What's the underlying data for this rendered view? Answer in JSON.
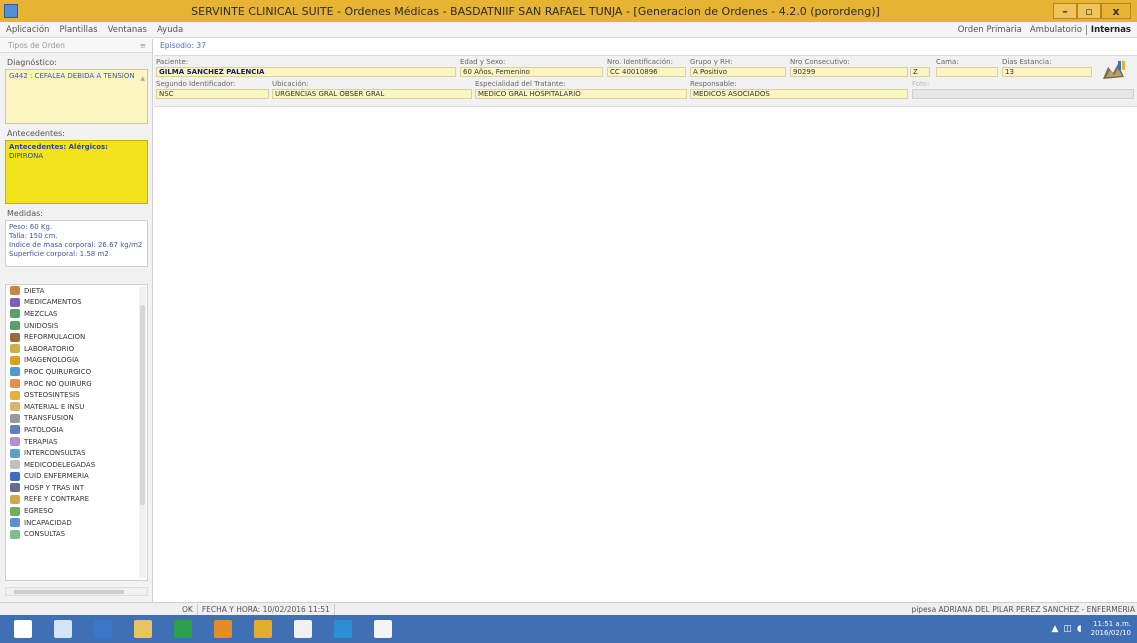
{
  "window": {
    "title": "SERVINTE CLINICAL SUITE - Ordenes Médicas - BASDATNIIF SAN RAFAEL TUNJA - [Generacion de Ordenes - 4.2.0 (porordeng)]",
    "minimize": "–",
    "maximize": "▫",
    "close": "x"
  },
  "menu": {
    "items": [
      "Aplicación",
      "Plantillas",
      "Ventanas",
      "Ayuda"
    ],
    "modes": [
      "Orden Primaria",
      "Ambulatorio",
      "Internas"
    ],
    "active_mode": "Internas"
  },
  "left_panel": {
    "header": "Tipos de Orden",
    "pin": "≡",
    "diagnostico_label": "Diagnóstico:",
    "diagnostico_text": "G442 : CEFALEA DEBIDA A TENSION",
    "antecedentes_label": "Antecedentes:",
    "antecedentes_title": "Antecedentes: Alérgicos:",
    "antecedentes_text": "DIPIRONA",
    "medidas_label": "Medidas:",
    "medidas_lines": [
      "Peso: 60 Kg.",
      "Talla: 150 cm.",
      "Indice de masa corporal: 26.67 kg/m2",
      "Superficie corporal: 1.58 m2"
    ],
    "order_types": [
      {
        "label": "DIETA",
        "color": "#c8873f"
      },
      {
        "label": "MEDICAMENTOS",
        "color": "#7c5fb6"
      },
      {
        "label": "MEZCLAS",
        "color": "#5aa06a"
      },
      {
        "label": "UNIDOSIS",
        "color": "#5aa06a"
      },
      {
        "label": "REFORMULACION",
        "color": "#9b6a3a"
      },
      {
        "label": "LABORATORIO",
        "color": "#c9b24a"
      },
      {
        "label": "IMAGENOLOGIA",
        "color": "#d9a21f"
      },
      {
        "label": "PROC QUIRURGICO",
        "color": "#4d9bd1"
      },
      {
        "label": "PROC NO QUIRURG",
        "color": "#e58f4a"
      },
      {
        "label": "OSTEOSINTESIS",
        "color": "#e0b33a"
      },
      {
        "label": "MATERIAL E INSU",
        "color": "#d8b56a"
      },
      {
        "label": "TRANSFUSION",
        "color": "#9a9a9a"
      },
      {
        "label": "PATOLOGIA",
        "color": "#5f7fbf"
      },
      {
        "label": "TERAPIAS",
        "color": "#b78fd0"
      },
      {
        "label": "INTERCONSULTAS",
        "color": "#5aa0c8"
      },
      {
        "label": "MEDICODELEGADAS",
        "color": "#c0c0c0"
      },
      {
        "label": "CUID ENFERMERIA",
        "color": "#3d6fc0"
      },
      {
        "label": "HOSP Y TRAS INT",
        "color": "#6a6a8a"
      },
      {
        "label": "REFE Y CONTRARE",
        "color": "#d1a84f"
      },
      {
        "label": "EGRESO",
        "color": "#6fae5e"
      },
      {
        "label": "INCAPACIDAD",
        "color": "#5a8fd0"
      },
      {
        "label": "CONSULTAS",
        "color": "#7cbf8a"
      }
    ]
  },
  "main": {
    "episode": "Episodio: 37",
    "labels": {
      "paciente": "Paciente:",
      "edad_sexo": "Edad y Sexo:",
      "nro_ident": "Nro. Identificación:",
      "grupo_rh": "Grupo y RH:",
      "nro_consec": "Nro Consecutivo:",
      "cama": "Cama:",
      "dias_estancia": "Dias Estancia:",
      "segundo_ident": "Segundo Identificador:",
      "ubicacion": "Ubicación:",
      "especialidad": "Especialidad del Tratante:",
      "responsable": "Responsable:",
      "foto": "Foto:"
    },
    "values": {
      "paciente": "GILMA SANCHEZ PALENCIA",
      "edad_sexo": "60 Años, Femenino",
      "nro_ident": "CC 40010896",
      "grupo_rh": "A Positivo",
      "nro_consec": "90299",
      "consec_suffix": "Z",
      "cama": "",
      "dias_estancia": "13",
      "segundo_ident": "NSC",
      "ubicacion": "URGENCIAS GRAL OBSER GRAL",
      "especialidad": "MEDICO GRAL HOSPITALARIO",
      "responsable": "MEDICOS ASOCIADOS"
    }
  },
  "status": {
    "state": "OK",
    "datetime": "FECHA Y HORA: 10/02/2016 11:51",
    "user": "pipesa ADRIANA DEL PILAR PEREZ SANCHEZ - ENFERMERIA"
  },
  "taskbar": {
    "apps": [
      {
        "name": "windows-start",
        "color": "#ffffff"
      },
      {
        "name": "file-explorer",
        "color": "#d4e3f5"
      },
      {
        "name": "app-z",
        "color": "#3a78c7"
      },
      {
        "name": "folder",
        "color": "#e8c460"
      },
      {
        "name": "app-browser",
        "color": "#2b9f4e"
      },
      {
        "name": "app-orange",
        "color": "#e38c2a"
      },
      {
        "name": "app-calc",
        "color": "#e2ad2c"
      },
      {
        "name": "app-settings",
        "color": "#f0f0f0"
      },
      {
        "name": "app-media",
        "color": "#2c8fd6"
      },
      {
        "name": "app-doc",
        "color": "#f4f4f4"
      }
    ],
    "clock_time": "11:51 a.m.",
    "clock_date": "2016/02/10"
  }
}
